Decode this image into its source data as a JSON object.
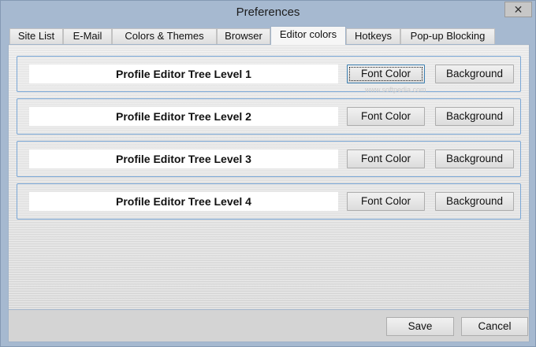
{
  "window": {
    "title": "Preferences",
    "close_glyph": "✕"
  },
  "tabs": [
    {
      "label": "Site List"
    },
    {
      "label": "E-Mail"
    },
    {
      "label": "Colors & Themes"
    },
    {
      "label": "Browser"
    },
    {
      "label": "Editor colors",
      "active": true
    },
    {
      "label": "Hotkeys"
    },
    {
      "label": "Pop-up Blocking"
    }
  ],
  "rows": [
    {
      "label": "Profile Editor Tree Level 1",
      "font_button": "Font Color",
      "bg_button": "Background"
    },
    {
      "label": "Profile Editor Tree Level 2",
      "font_button": "Font Color",
      "bg_button": "Background"
    },
    {
      "label": "Profile Editor Tree Level 3",
      "font_button": "Font Color",
      "bg_button": "Background"
    },
    {
      "label": "Profile Editor Tree Level 4",
      "font_button": "Font Color",
      "bg_button": "Background"
    }
  ],
  "watermark": "www.softpedia.com",
  "footer": {
    "save_label": "Save",
    "cancel_label": "Cancel"
  },
  "colors": {
    "accent_border": "#7aa7d6",
    "window_frame": "#a6b9d0"
  }
}
